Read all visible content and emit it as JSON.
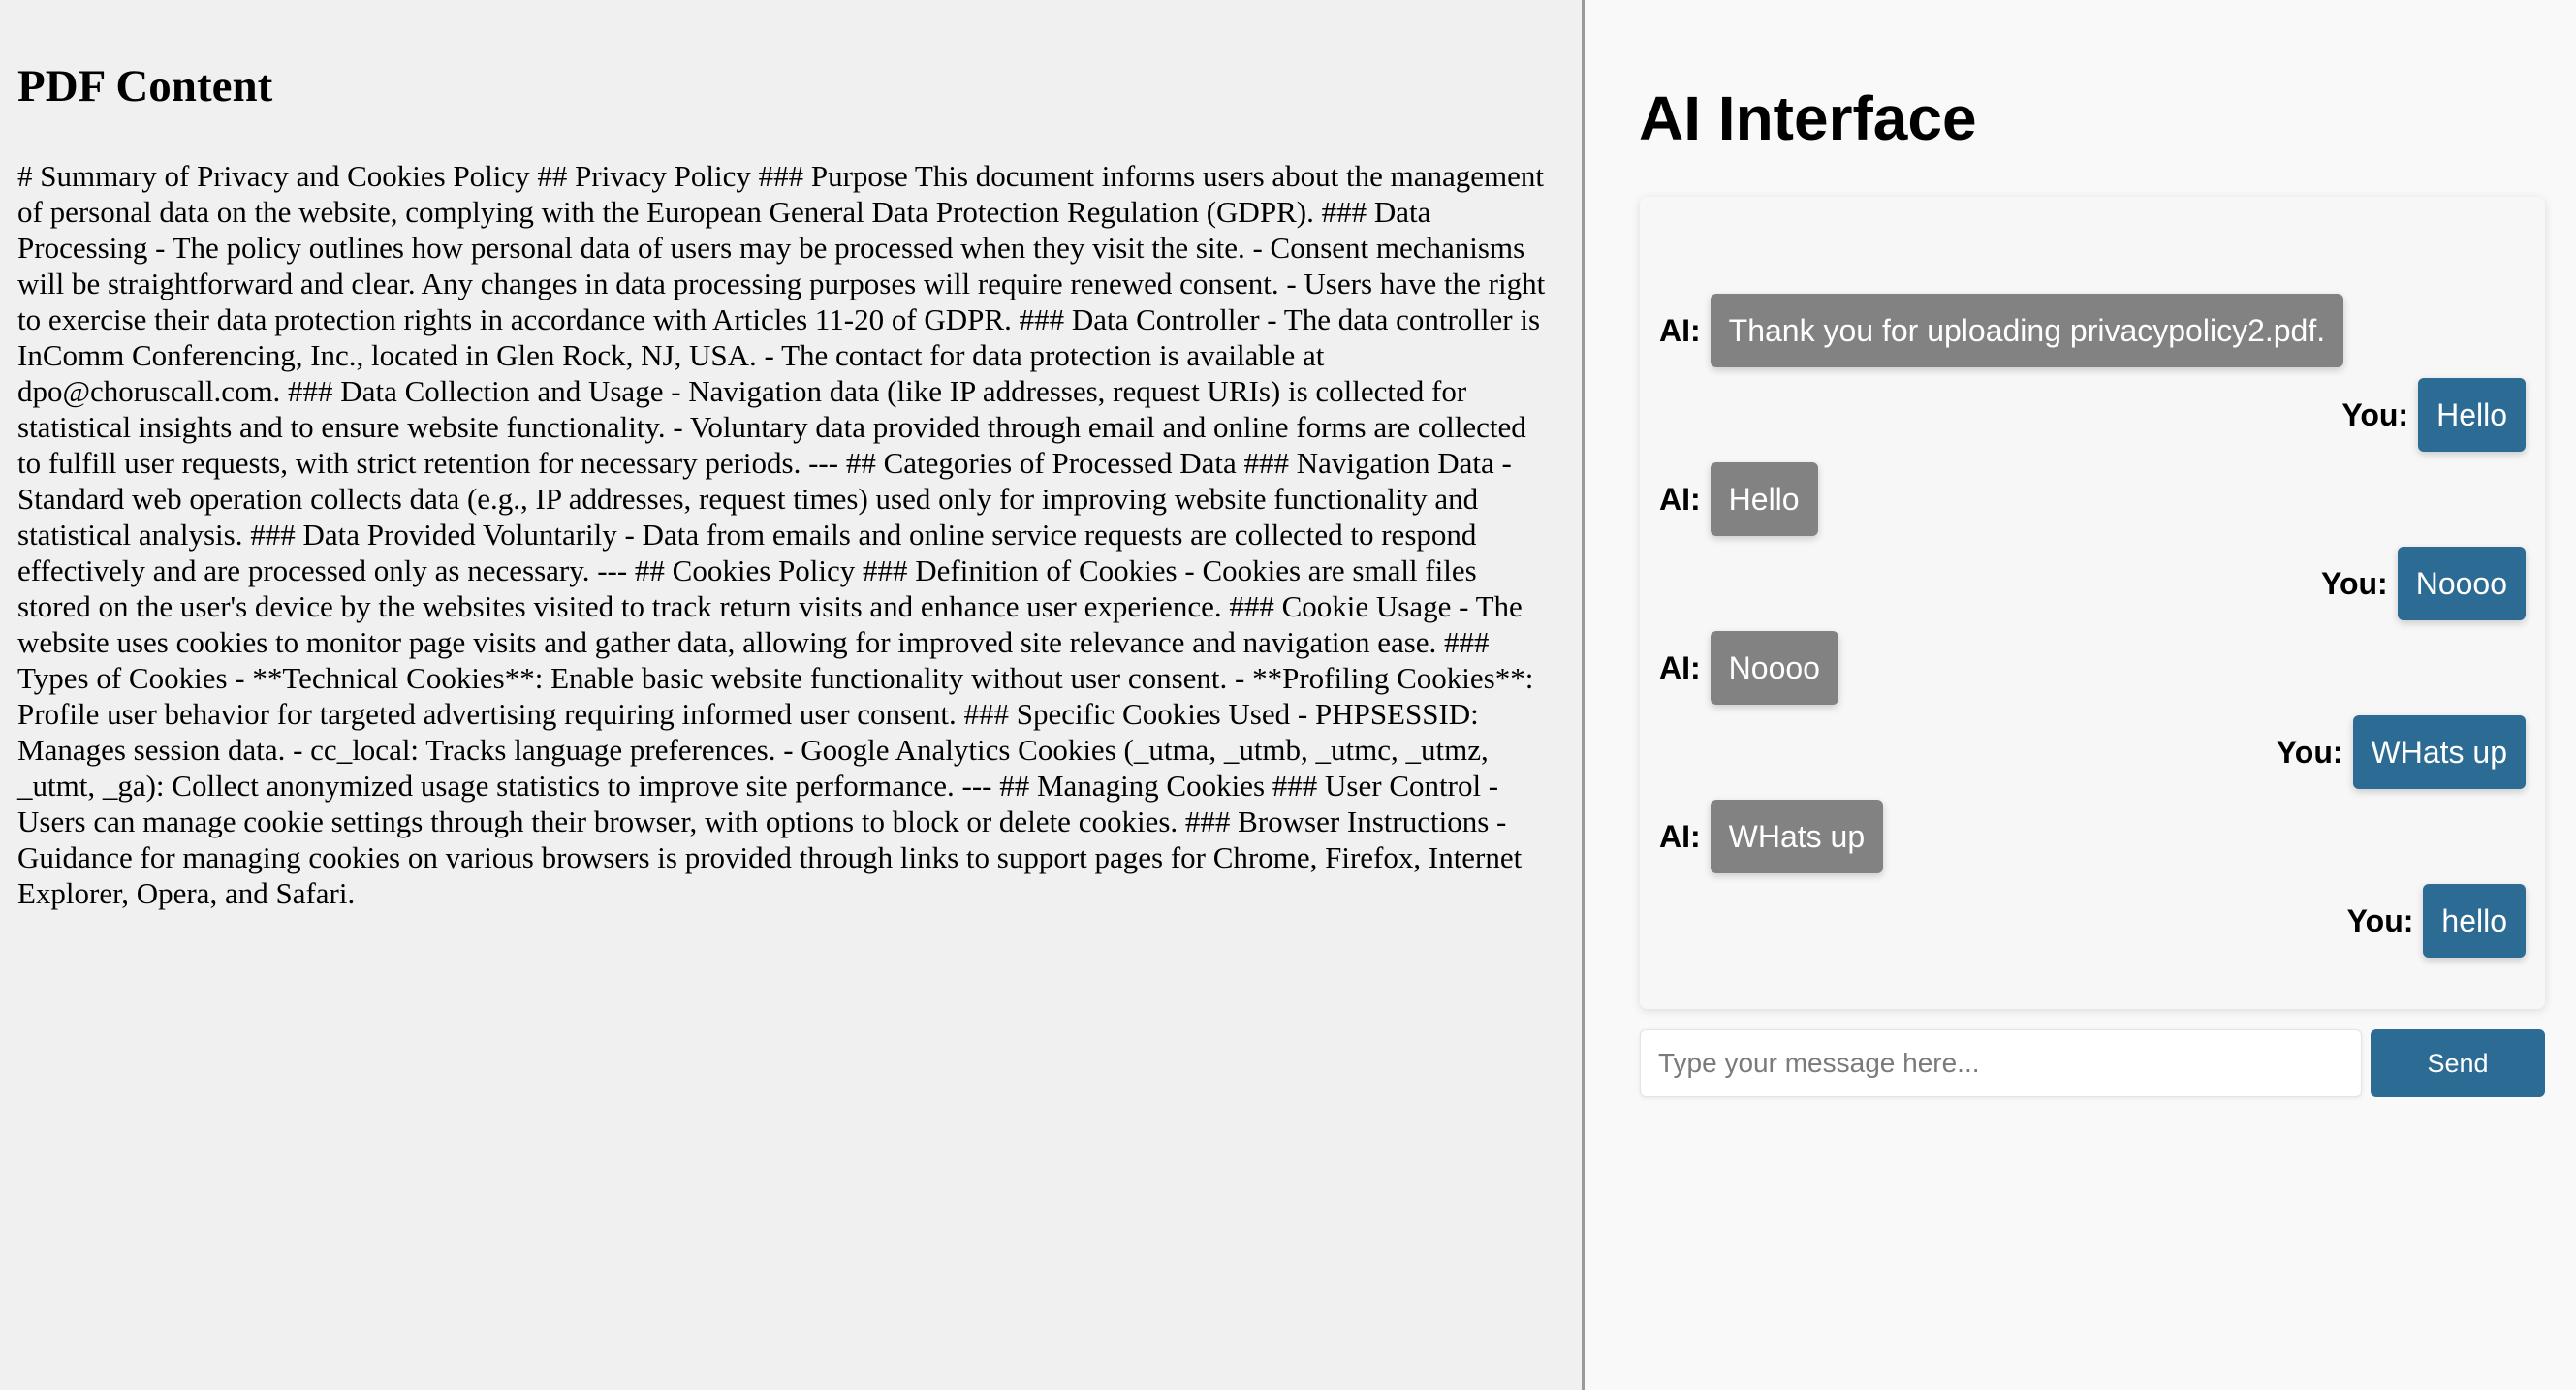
{
  "pdf": {
    "title": "PDF Content",
    "body": "# Summary of Privacy and Cookies Policy ## Privacy Policy ### Purpose This document informs users about the management of personal data on the website, complying with the European General Data Protection Regulation (GDPR). ### Data Processing - The policy outlines how personal data of users may be processed when they visit the site. - Consent mechanisms will be straightforward and clear. Any changes in data processing purposes will require renewed consent. - Users have the right to exercise their data protection rights in accordance with Articles 11-20 of GDPR. ### Data Controller - The data controller is InComm Conferencing, Inc., located in Glen Rock, NJ, USA. - The contact for data protection is available at dpo@choruscall.com. ### Data Collection and Usage - Navigation data (like IP addresses, request URIs) is collected for statistical insights and to ensure website functionality. - Voluntary data provided through email and online forms are collected to fulfill user requests, with strict retention for necessary periods. --- ## Categories of Processed Data ### Navigation Data - Standard web operation collects data (e.g., IP addresses, request times) used only for improving website functionality and statistical analysis. ### Data Provided Voluntarily - Data from emails and online service requests are collected to respond effectively and are processed only as necessary. --- ## Cookies Policy ### Definition of Cookies - Cookies are small files stored on the user's device by the websites visited to track return visits and enhance user experience. ### Cookie Usage - The website uses cookies to monitor page visits and gather data, allowing for improved site relevance and navigation ease. ### Types of Cookies - **Technical Cookies**: Enable basic website functionality without user consent. - **Profiling Cookies**: Profile user behavior for targeted advertising requiring informed user consent. ### Specific Cookies Used - PHPSESSID: Manages session data. - cc_local: Tracks language preferences. - Google Analytics Cookies (_utma, _utmb, _utmc, _utmz, _utmt, _ga): Collect anonymized usage statistics to improve site performance. --- ## Managing Cookies ### User Control - Users can manage cookie settings through their browser, with options to block or delete cookies. ### Browser Instructions - Guidance for managing cookies on various browsers is provided through links to support pages for Chrome, Firefox, Internet Explorer, Opera, and Safari."
  },
  "ai": {
    "title": "AI Interface",
    "messages": [
      {
        "sender": "AI:",
        "role": "ai",
        "text": "Thank you for uploading privacypolicy2.pdf."
      },
      {
        "sender": "You:",
        "role": "you",
        "text": "Hello"
      },
      {
        "sender": "AI:",
        "role": "ai",
        "text": "Hello"
      },
      {
        "sender": "You:",
        "role": "you",
        "text": "Noooo"
      },
      {
        "sender": "AI:",
        "role": "ai",
        "text": "Noooo"
      },
      {
        "sender": "You:",
        "role": "you",
        "text": "WHats up"
      },
      {
        "sender": "AI:",
        "role": "ai",
        "text": "WHats up"
      },
      {
        "sender": "You:",
        "role": "you",
        "text": "hello"
      }
    ],
    "input": {
      "placeholder": "Type your message here...",
      "value": ""
    },
    "send_label": "Send"
  },
  "colors": {
    "ai_bubble": "#828282",
    "user_bubble": "#2b6b94",
    "send_button": "#2b6b94",
    "left_background": "#f0f0f0",
    "right_background": "#f9f9f9"
  }
}
